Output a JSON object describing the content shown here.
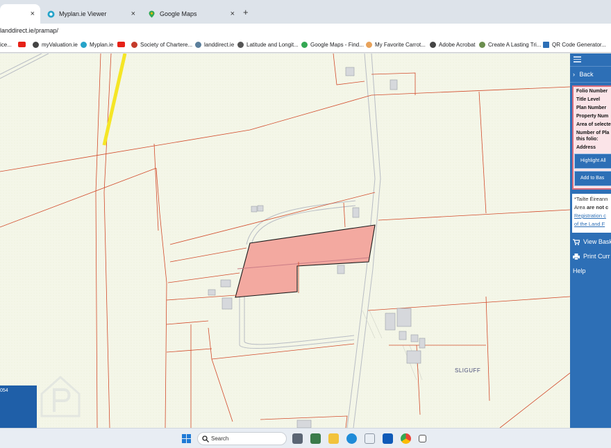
{
  "browser": {
    "tabs": [
      {
        "label": "",
        "active": true
      },
      {
        "label": "Myplan.ie Viewer",
        "active": false
      },
      {
        "label": "Google Maps",
        "active": false
      }
    ],
    "new_tab": "+",
    "close": "×",
    "url": "landdirect.ie/pramap/"
  },
  "bookmarks": [
    {
      "label": "ice..."
    },
    {
      "label": ""
    },
    {
      "label": "myValuation.ie"
    },
    {
      "label": "Myplan.ie"
    },
    {
      "label": ""
    },
    {
      "label": "Society of Chartere..."
    },
    {
      "label": "landdirect.ie"
    },
    {
      "label": "Latitude and Longit..."
    },
    {
      "label": "Google Maps - Find..."
    },
    {
      "label": "My Favorite Carrot..."
    },
    {
      "label": "Adobe Acrobat"
    },
    {
      "label": "Create A Lasting Tri..."
    },
    {
      "label": "QR Code Generator..."
    }
  ],
  "map": {
    "place_label": "SLIGUFF",
    "scale_text": "054",
    "selected_parcel_color": "#f3a9a0"
  },
  "side_panel": {
    "back_label": "Back",
    "info_rows": [
      "Folio Number",
      "Title Level",
      "Plan Number",
      "Property Num",
      "Area of selecte",
      "Number of Pla",
      "this folio:",
      "Address"
    ],
    "highlight_button": "Highlight All",
    "add_button": "Add to Bas",
    "notice_line1": "*Tailte Éireann",
    "notice_line2_pre": "Area",
    "notice_line2_bold": "are not c",
    "notice_link1": "Registration c",
    "notice_link2": "of the Land F",
    "view_basket": "View Bask",
    "print_current": "Print Curr",
    "help": "Help"
  },
  "taskbar": {
    "search_placeholder": "Search"
  },
  "colors": {
    "panel_blue": "#2d6fb6",
    "map_background": "#f4f6e8",
    "boundary_line": "#d24a2a",
    "highlight_road": "#f5e626"
  }
}
